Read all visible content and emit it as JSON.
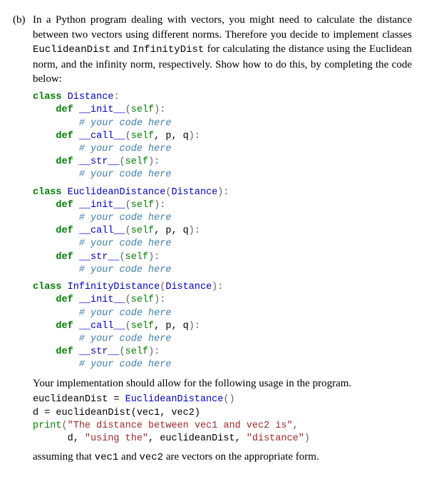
{
  "label": "(b)",
  "intro": "In a Python program dealing with vectors, you might need to calculate the distance between two vectors using different norms. Therefore you decide to implement classes ",
  "cls_euclid_tt": "EuclideanDist",
  "intro_mid1": " and ",
  "cls_inf_tt": "InfinityDist",
  "intro_tail": " for calculating the distance using the Euclidean norm, and the infinity norm, respectively. Show how to do this, by completing the code below:",
  "code1": {
    "c1_kw": "class",
    "c1_name": "Distance",
    "c1_colon": ":",
    "d1_kw": "def",
    "d1_name": "__init__",
    "d1_sig_open": "(",
    "d1_self": "self",
    "d1_sig_close": "):",
    "cmt": "# your code here",
    "d2_kw": "def",
    "d2_name": "__call__",
    "d2_sig_open": "(",
    "d2_self": "self",
    "d2_args": ", p, q",
    "d2_sig_close": "):",
    "d3_kw": "def",
    "d3_name": "__str__",
    "d3_sig_open": "(",
    "d3_self": "self",
    "d3_sig_close": "):"
  },
  "code2": {
    "c_kw": "class",
    "c_name": "EuclideanDistance",
    "c_base_open": "(",
    "c_base": "Distance",
    "c_base_close": "):",
    "d1_kw": "def",
    "d1_name": "__init__",
    "d1_sig_open": "(",
    "d1_self": "self",
    "d1_sig_close": "):",
    "cmt": "# your code here",
    "d2_kw": "def",
    "d2_name": "__call__",
    "d2_sig_open": "(",
    "d2_self": "self",
    "d2_args": ", p, q",
    "d2_sig_close": "):",
    "d3_kw": "def",
    "d3_name": "__str__",
    "d3_sig_open": "(",
    "d3_self": "self",
    "d3_sig_close": "):"
  },
  "code3": {
    "c_kw": "class",
    "c_name": "InfinityDistance",
    "c_base_open": "(",
    "c_base": "Distance",
    "c_base_close": "):",
    "d1_kw": "def",
    "d1_name": "__init__",
    "d1_sig_open": "(",
    "d1_self": "self",
    "d1_sig_close": "):",
    "cmt": "# your code here",
    "d2_kw": "def",
    "d2_name": "__call__",
    "d2_sig_open": "(",
    "d2_self": "self",
    "d2_args": ", p, q",
    "d2_sig_close": "):",
    "d3_kw": "def",
    "d3_name": "__str__",
    "d3_sig_open": "(",
    "d3_self": "self",
    "d3_sig_close": "):"
  },
  "middle_para": "Your implementation should allow for the following usage in the program.",
  "usage": {
    "l1_a": "euclideanDist = ",
    "l1_b": "EuclideanDistance",
    "l1_c": "()",
    "l2": "d = euclideanDist(vec1, vec2)",
    "l3_print": "print",
    "l3_open": "(",
    "l3_s1": "\"The distance between vec1 and vec2 is\"",
    "l3_comma": ",",
    "l4_indent": "      ",
    "l4_d": "d, ",
    "l4_s2": "\"using the\"",
    "l4_mid": ", euclideanDist, ",
    "l4_s3": "\"distance\"",
    "l4_close": ")"
  },
  "outro_a": "assuming that ",
  "outro_vec1": "vec1",
  "outro_mid": " and ",
  "outro_vec2": "vec2",
  "outro_b": " are vectors on the appropriate form."
}
